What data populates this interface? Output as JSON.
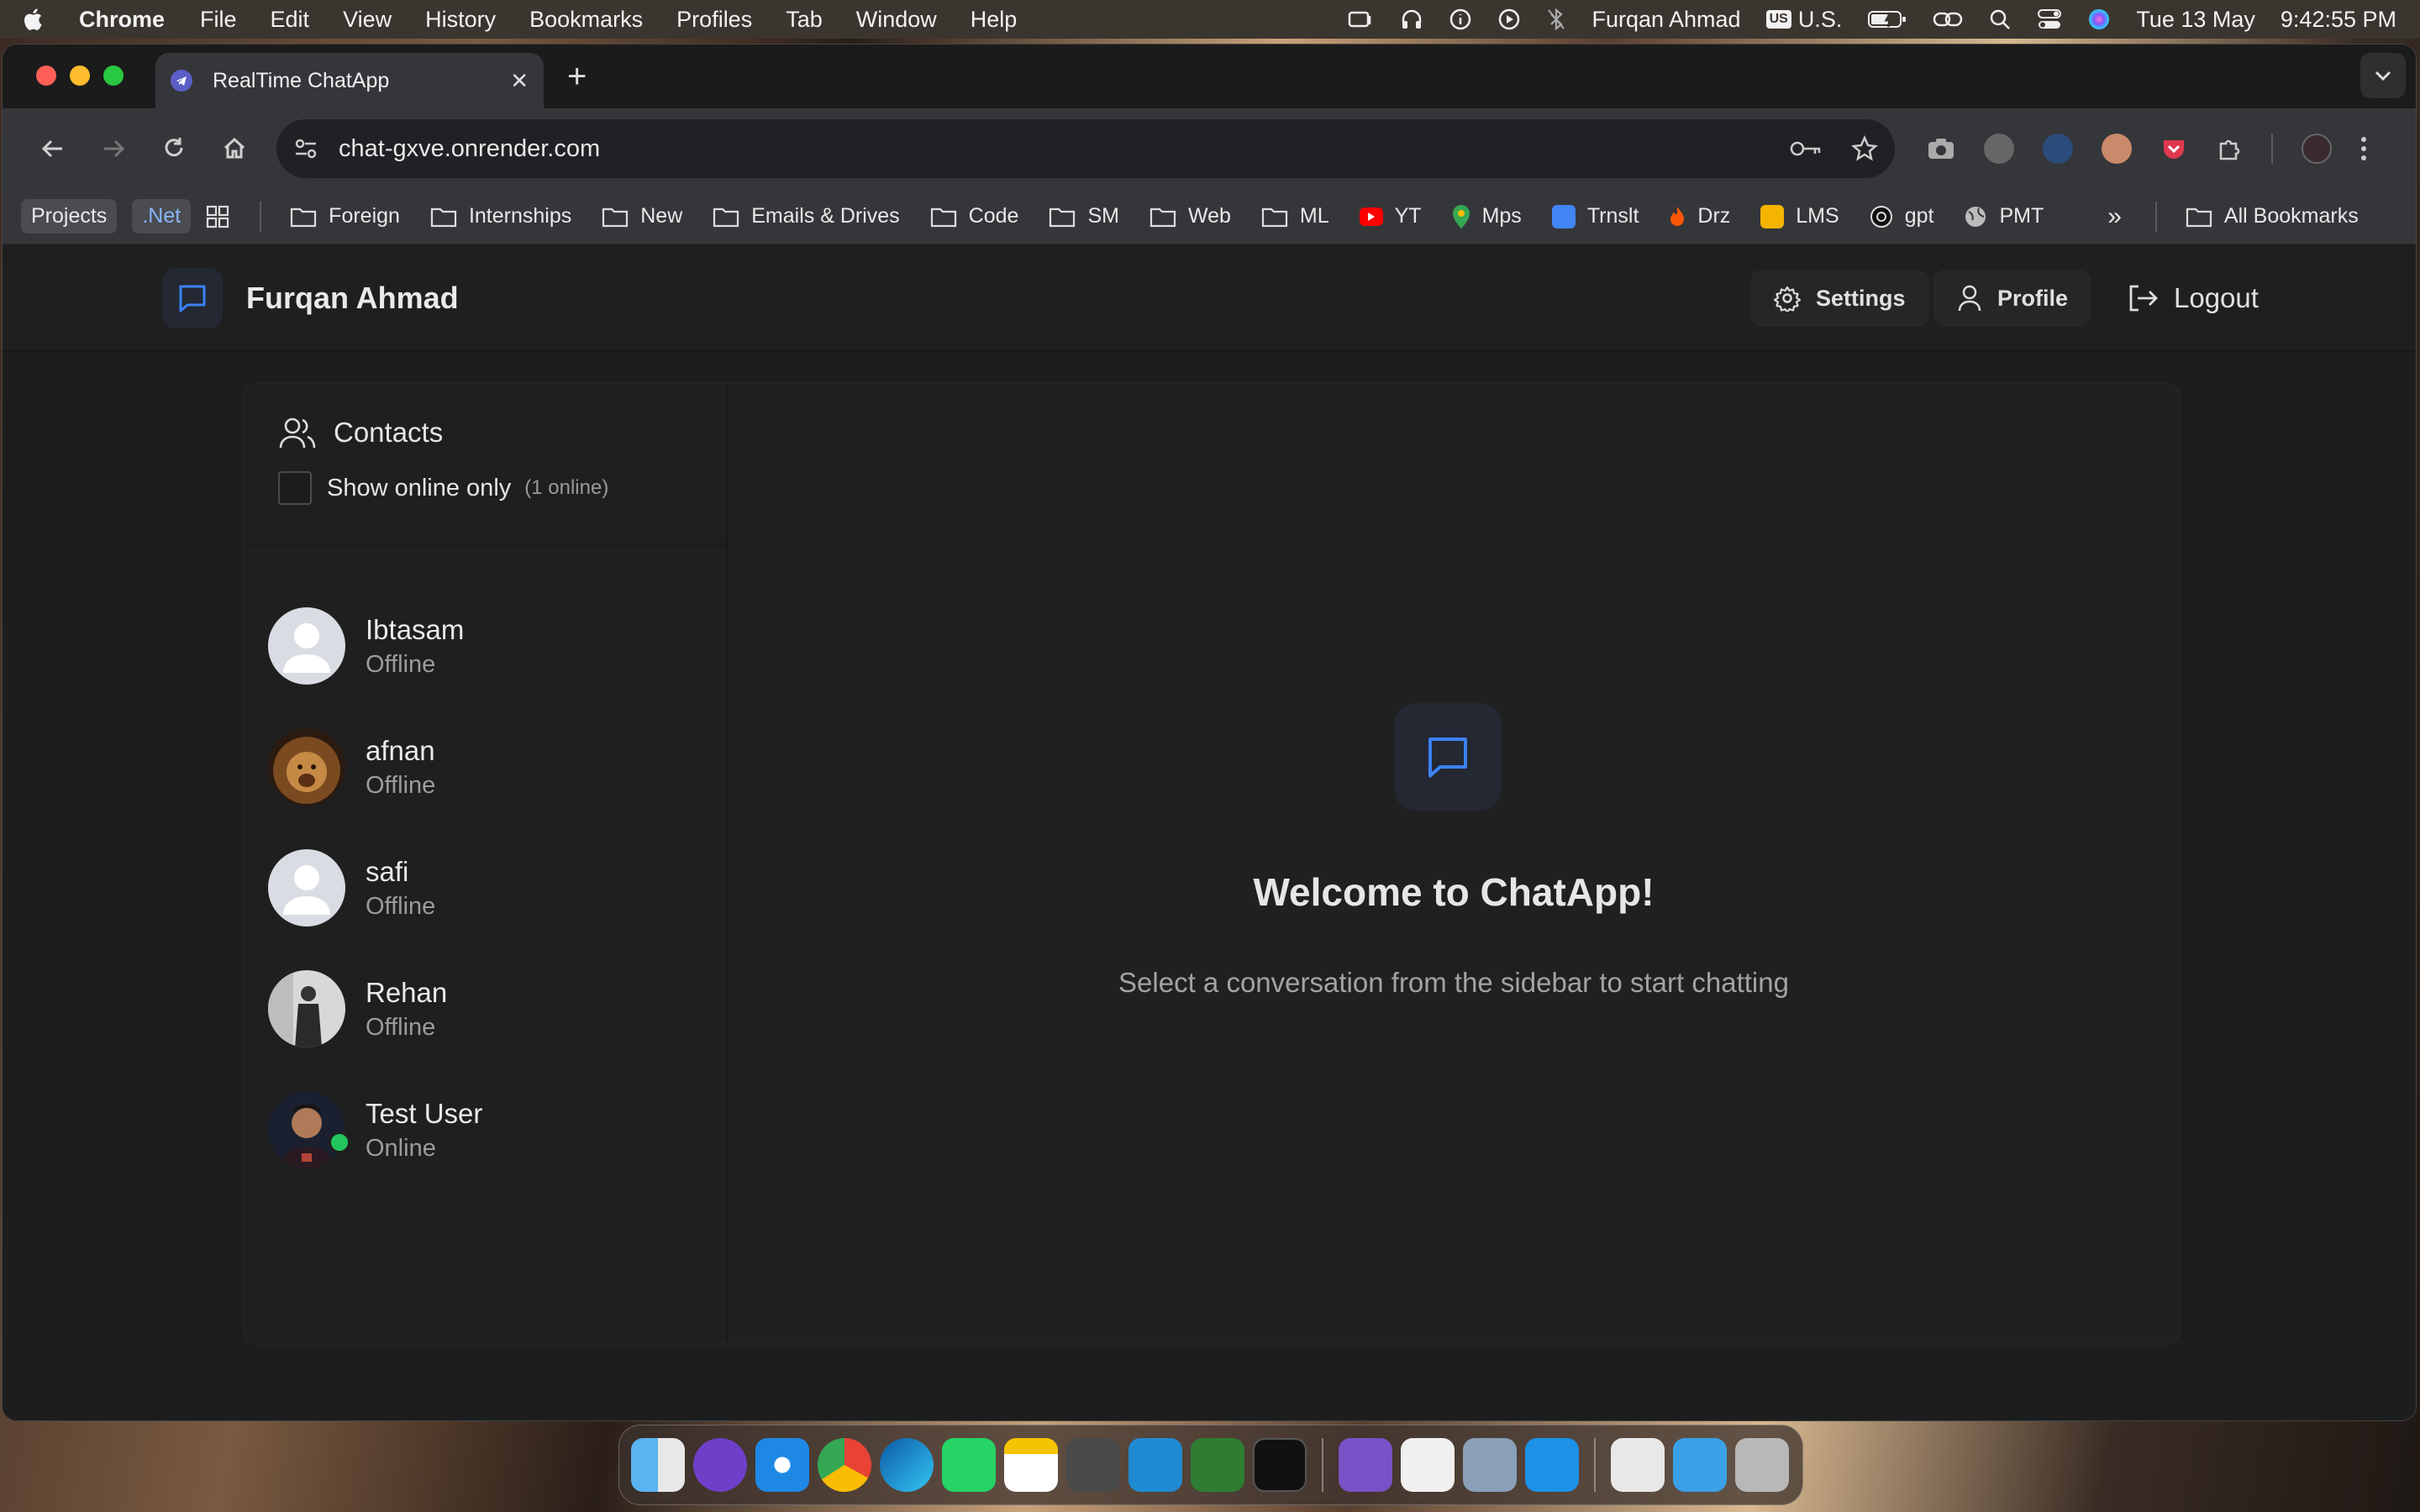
{
  "menubar": {
    "app": "Chrome",
    "items": [
      "File",
      "Edit",
      "View",
      "History",
      "Bookmarks",
      "Profiles",
      "Tab",
      "Window",
      "Help"
    ],
    "user": "Furqan Ahmad",
    "input_badge": "US",
    "input_source": "U.S.",
    "date": "Tue 13 May",
    "time": "9:42:55 PM"
  },
  "browser": {
    "tab_title": "RealTime ChatApp",
    "url": "chat-gxve.onrender.com",
    "bookmarks": {
      "pills": [
        "Projects",
        ".Net"
      ],
      "folders": [
        "Foreign",
        "Internships",
        "New",
        "Emails & Drives",
        "Code",
        "SM",
        "Web",
        "ML"
      ],
      "sites": [
        "YT",
        "Mps",
        "Trnslt",
        "Drz",
        "LMS",
        "gpt",
        "PMT"
      ],
      "overflow": "»",
      "all": "All Bookmarks"
    }
  },
  "app": {
    "user_name": "Furqan Ahmad",
    "settings_label": "Settings",
    "profile_label": "Profile",
    "logout_label": "Logout",
    "contacts_title": "Contacts",
    "filter_label": "Show online only",
    "online_count": "(1 online)",
    "contacts": [
      {
        "name": "Ibtasam",
        "status": "Offline"
      },
      {
        "name": "afnan",
        "status": "Offline"
      },
      {
        "name": "safi",
        "status": "Offline"
      },
      {
        "name": "Rehan",
        "status": "Offline"
      },
      {
        "name": "Test User",
        "status": "Online"
      }
    ],
    "welcome_title": "Welcome to ChatApp!",
    "welcome_subtitle": "Select a conversation from the sidebar to start chatting"
  },
  "colors": {
    "online": "#22c55e",
    "accent": "#3b82f6",
    "page_bg": "#1d1d1d"
  }
}
